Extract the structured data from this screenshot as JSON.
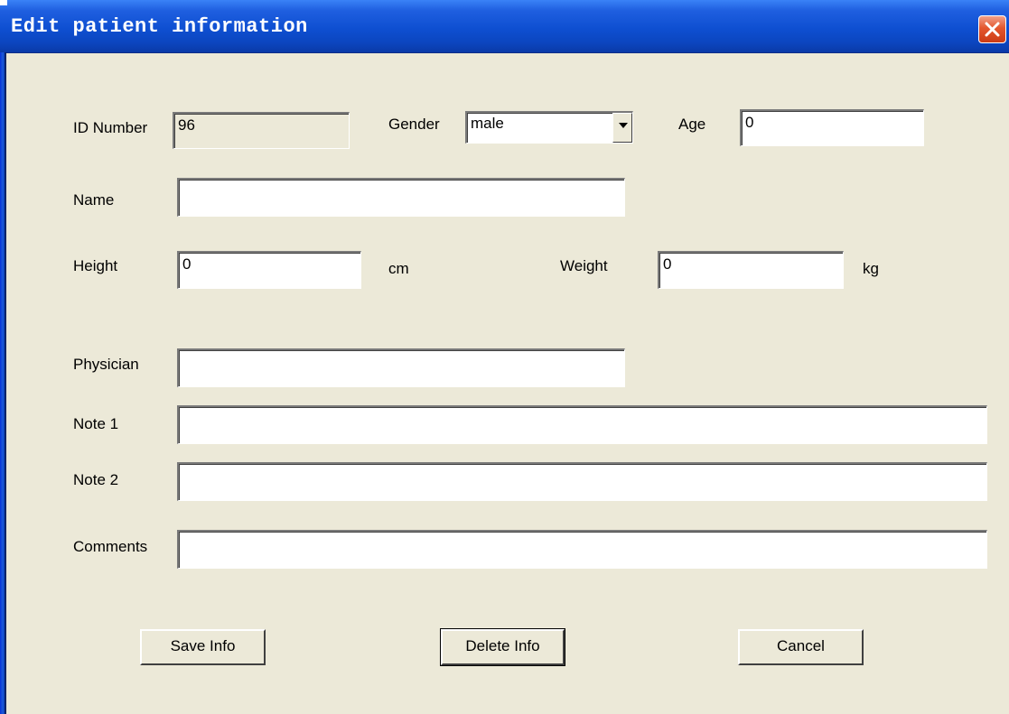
{
  "window": {
    "title": "Edit patient information"
  },
  "form": {
    "id_number": {
      "label": "ID Number",
      "value": "96"
    },
    "gender": {
      "label": "Gender",
      "value": "male"
    },
    "age": {
      "label": "Age",
      "value": "0"
    },
    "name": {
      "label": "Name",
      "value": ""
    },
    "height": {
      "label": "Height",
      "value": "0",
      "unit": "cm"
    },
    "weight": {
      "label": "Weight",
      "value": "0",
      "unit": "kg"
    },
    "physician": {
      "label": "Physician",
      "value": ""
    },
    "note1": {
      "label": "Note 1",
      "value": ""
    },
    "note2": {
      "label": "Note 2",
      "value": ""
    },
    "comments": {
      "label": "Comments",
      "value": ""
    }
  },
  "buttons": {
    "save": "Save Info",
    "delete": "Delete Info",
    "cancel": "Cancel"
  },
  "icons": {
    "close": "close-icon",
    "dropdown": "chevron-down-icon"
  }
}
